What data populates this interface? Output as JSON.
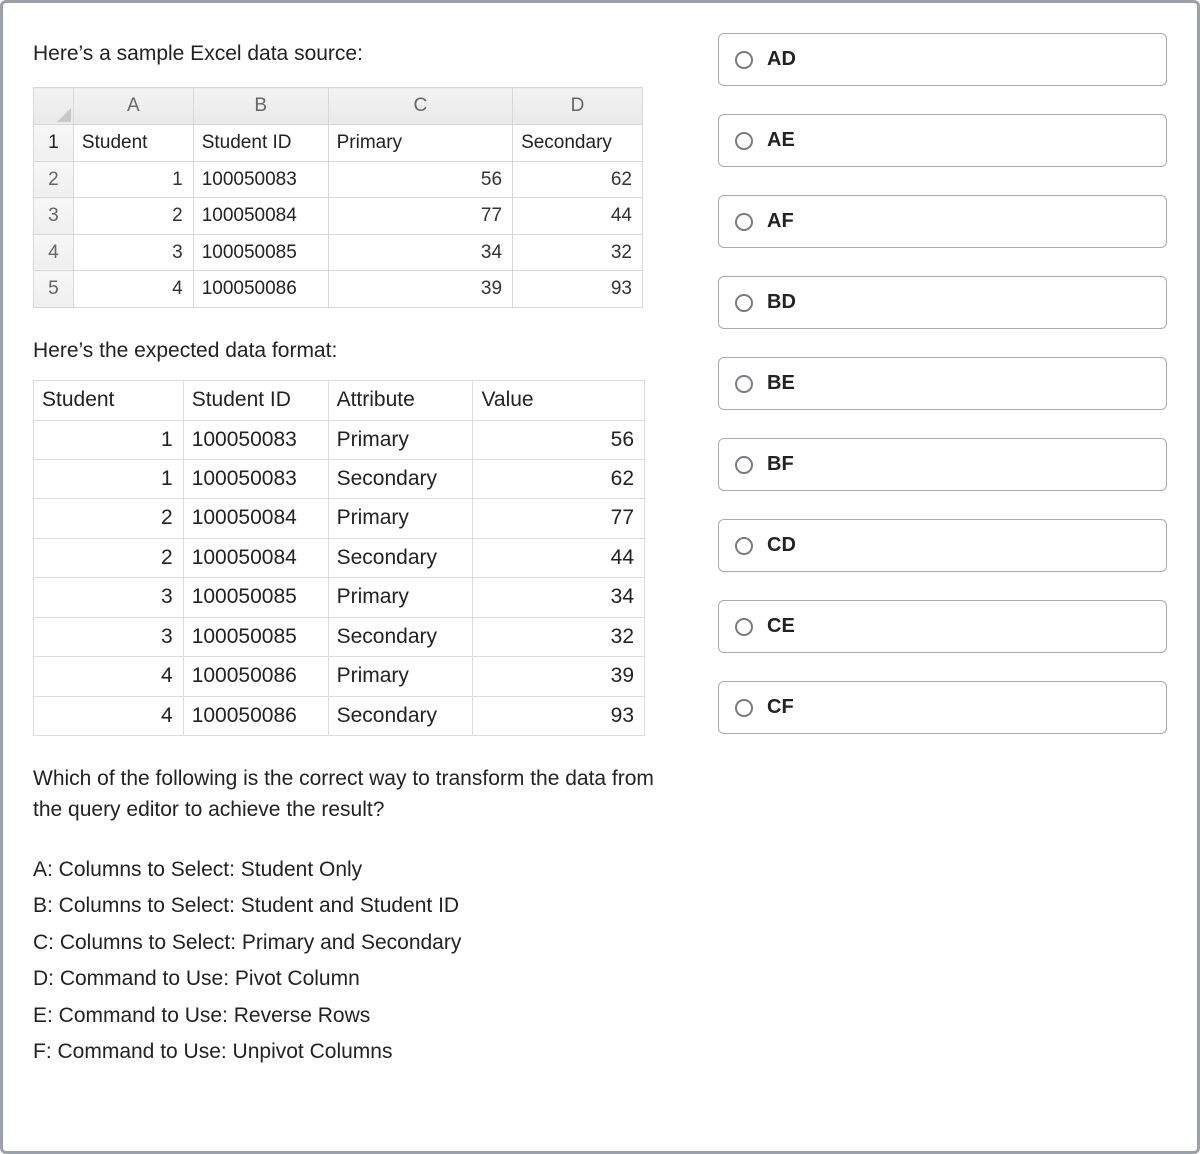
{
  "intro": "Here’s a sample Excel data source:",
  "source_table": {
    "col_letters": [
      "A",
      "B",
      "C",
      "D"
    ],
    "row_numbers": [
      "1",
      "2",
      "3",
      "4",
      "5"
    ],
    "header_row": [
      "Student",
      "Student ID",
      "Primary",
      "Secondary"
    ],
    "data_rows": [
      [
        "1",
        "100050083",
        "56",
        "62"
      ],
      [
        "2",
        "100050084",
        "77",
        "44"
      ],
      [
        "3",
        "100050085",
        "34",
        "32"
      ],
      [
        "4",
        "100050086",
        "39",
        "93"
      ]
    ]
  },
  "expected_label": "Here’s the expected data format:",
  "expected_table": {
    "headers": [
      "Student",
      "Student ID",
      "Attribute",
      "Value"
    ],
    "rows": [
      [
        "1",
        "100050083",
        "Primary",
        "56"
      ],
      [
        "1",
        "100050083",
        "Secondary",
        "62"
      ],
      [
        "2",
        "100050084",
        "Primary",
        "77"
      ],
      [
        "2",
        "100050084",
        "Secondary",
        "44"
      ],
      [
        "3",
        "100050085",
        "Primary",
        "34"
      ],
      [
        "3",
        "100050085",
        "Secondary",
        "32"
      ],
      [
        "4",
        "100050086",
        "Primary",
        "39"
      ],
      [
        "4",
        "100050086",
        "Secondary",
        "93"
      ]
    ]
  },
  "question": "Which of the following is the correct way to transform the data from the query editor to achieve the result?",
  "option_defs": [
    "A: Columns to Select: Student Only",
    "B: Columns to Select: Student and Student ID",
    "C: Columns to Select: Primary and Secondary",
    "D: Command to Use: Pivot Column",
    "E: Command to Use: Reverse Rows",
    "F: Command to Use: Unpivot Columns"
  ],
  "answers": [
    "AD",
    "AE",
    "AF",
    "BD",
    "BE",
    "BF",
    "CD",
    "CE",
    "CF"
  ]
}
